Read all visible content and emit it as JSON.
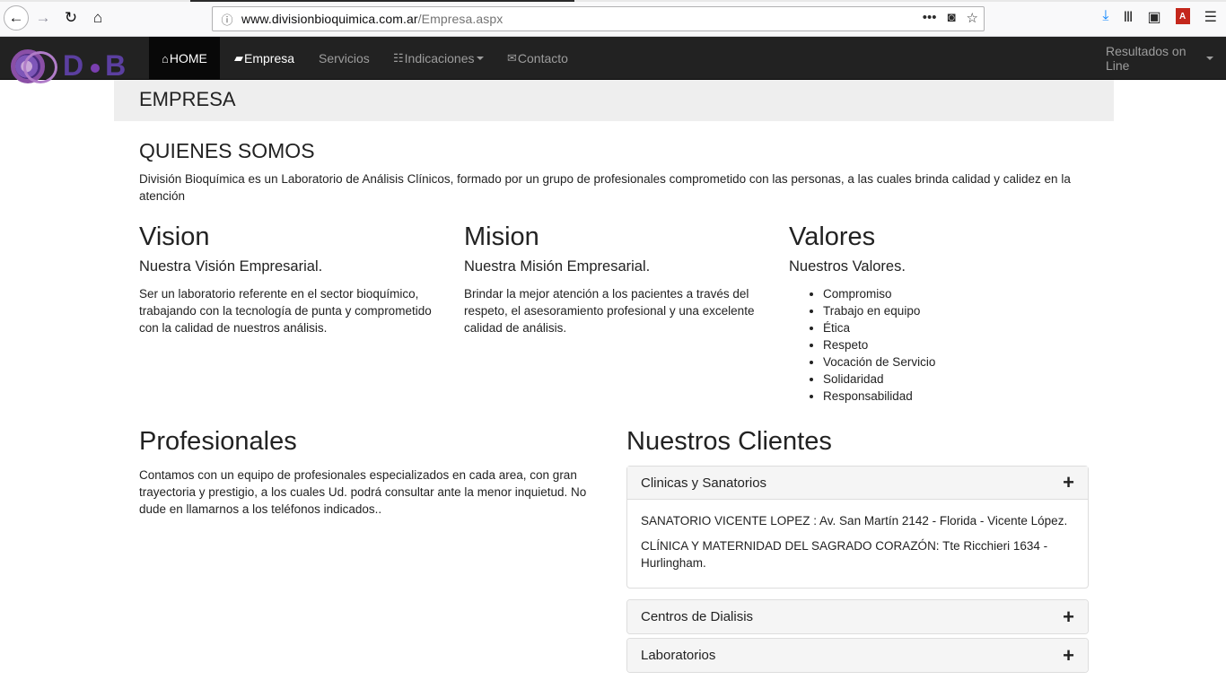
{
  "browser": {
    "url_domain": "www.divisionbioquimica.com.ar",
    "url_path": "/Empresa.aspx"
  },
  "navbar": {
    "logo_text_left": "D",
    "logo_text_right": "B",
    "items": [
      {
        "label": "HOME",
        "icon": "home-icon"
      },
      {
        "label": "Empresa",
        "icon": "briefcase-icon"
      },
      {
        "label": "Servicios"
      },
      {
        "label": "Indicaciones",
        "icon": "list-icon"
      },
      {
        "label": "Contacto",
        "icon": "envelope-icon"
      }
    ],
    "right_label": "Resultados on Line"
  },
  "header": {
    "title": "EMPRESA"
  },
  "quienes": {
    "title": "QUIENES SOMOS",
    "text": "División Bioquímica es un Laboratorio de Análisis Clínicos, formado por un grupo de profesionales comprometido con las personas, a las cuales brinda calidad y calidez en la atención"
  },
  "vision": {
    "title": "Vision",
    "subtitle": "Nuestra Visión Empresarial.",
    "text": "Ser un laboratorio referente en el sector bioquímico, trabajando con la tecnología de punta y comprometido con la calidad de nuestros análisis."
  },
  "mision": {
    "title": "Mision",
    "subtitle": "Nuestra Misión Empresarial.",
    "text": "Brindar la mejor atención a los pacientes a través del respeto, el asesoramiento profesional y una excelente calidad de análisis."
  },
  "valores": {
    "title": "Valores",
    "subtitle": "Nuestros Valores.",
    "items": [
      "Compromiso",
      "Trabajo en equipo",
      "Ética",
      "Respeto",
      "Vocación de Servicio",
      "Solidaridad",
      "Responsabilidad"
    ]
  },
  "profesionales": {
    "title": "Profesionales",
    "text": "Contamos con un equipo de profesionales especializados en cada area, con gran trayectoria y prestigio, a los cuales Ud. podrá consultar ante la menor inquietud. No dude en llamarnos a los teléfonos indicados.."
  },
  "clientes": {
    "title": "Nuestros Clientes",
    "panels": [
      {
        "title": "Clinicas y Sanatorios",
        "toggle": "+",
        "items": [
          "SANATORIO VICENTE LOPEZ : Av. San Martín 2142 - Florida - Vicente López.",
          "CLÍNICA Y MATERNIDAD DEL SAGRADO CORAZÓN: Tte Ricchieri 1634 - Hurlingham."
        ]
      },
      {
        "title": "Centros de Dialisis",
        "toggle": "+"
      },
      {
        "title": "Laboratorios",
        "toggle": "+"
      }
    ]
  }
}
